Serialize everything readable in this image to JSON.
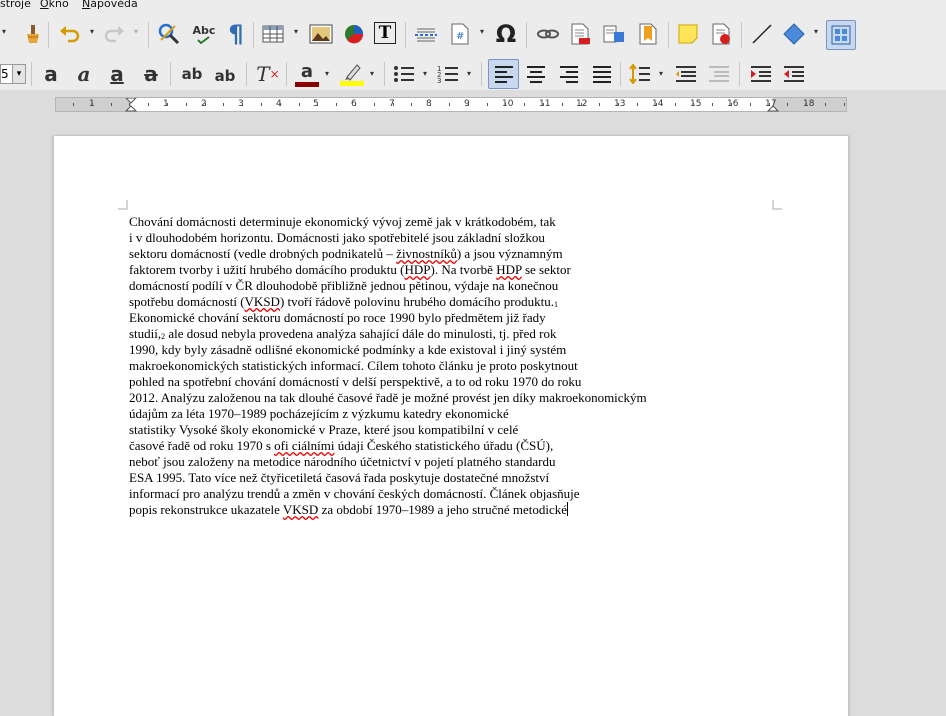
{
  "menu": {
    "items": [
      {
        "label": "stroje",
        "mnemonic": ""
      },
      {
        "label": "kno",
        "mnemonic": "O"
      },
      {
        "label": "ápověda",
        "mnemonic": "N"
      }
    ]
  },
  "toolbar": {
    "font_size_value": "5",
    "spellcheck_label": "Abc",
    "pilcrow_glyph": "¶",
    "omega_glyph": "Ω",
    "field_glyph": "#",
    "textbox_glyph": "T",
    "bold_glyph": "a",
    "italic_glyph": "a",
    "underline_glyph": "a",
    "strike_glyph": "a",
    "superscript_glyph": "ab",
    "subscript_glyph": "ab",
    "clear_glyph": "T",
    "font_color_glyph": "a",
    "font_color": "#8b0000",
    "highlight_color": "#ffff00"
  },
  "ruler": {
    "labels": [
      "1",
      "1",
      "2",
      "3",
      "4",
      "5",
      "6",
      "7",
      "8",
      "9",
      "10",
      "11",
      "12",
      "13",
      "14",
      "15",
      "16",
      "17",
      "18"
    ]
  },
  "document": {
    "lines": [
      [
        {
          "t": "Chování domácnosti determinuje ekonomický vývoj země jak v krátkodobém, tak"
        }
      ],
      [
        {
          "t": "i v dlouhodobém horizontu. Domácnosti jako spotřebitelé jsou základní složkou"
        }
      ],
      [
        {
          "t": "sektoru domácností (vedle drobných podnikatelů – "
        },
        {
          "t": "živnostníků",
          "s": 1
        },
        {
          "t": ") a jsou významným"
        }
      ],
      [
        {
          "t": "faktorem tvorby i užití hrubého domácího produktu ("
        },
        {
          "t": "HDP",
          "s": 1
        },
        {
          "t": "). Na tvorbě "
        },
        {
          "t": "HDP",
          "s": 1
        },
        {
          "t": " se sektor"
        }
      ],
      [
        {
          "t": "domácností podílí v ČR dlouhodobě přibližně jednou pětinou, výdaje na konečnou"
        }
      ],
      [
        {
          "t": "spotřebu domácností ("
        },
        {
          "t": "VKSD",
          "s": 1
        },
        {
          "t": ") tvoří řádově polovinu hrubého domácího produktu."
        },
        {
          "t": "1",
          "sup": 1
        }
      ],
      [
        {
          "t": "Ekonomické chování sektoru domácností po roce 1990 bylo předmětem již řady"
        }
      ],
      [
        {
          "t": "studií,"
        },
        {
          "t": "2",
          "sup": 1
        },
        {
          "t": " ale dosud nebyla provedena analýza sahající dále do minulosti, tj. před rok"
        }
      ],
      [
        {
          "t": "1990, kdy byly zásadně odlišné ekonomické podmínky a kde existoval i jiný systém"
        }
      ],
      [
        {
          "t": "makroekonomických statistických informací. Cílem tohoto článku je proto poskytnout"
        }
      ],
      [
        {
          "t": "pohled na spotřební chování domácností v delší perspektivě, a to od roku 1970 do roku"
        }
      ],
      [
        {
          "t": "2012. Analýzu založenou na tak dlouhé časové řadě je možné provést jen díky makroekonomickým"
        }
      ],
      [
        {
          "t": "údajům za léta 1970–1989 pocházejícím z výzkumu katedry ekonomické"
        }
      ],
      [
        {
          "t": "statistiky Vysoké školy ekonomické v Praze, které jsou kompatibilní v celé"
        }
      ],
      [
        {
          "t": "časové řadě od roku 1970 s "
        },
        {
          "t": "ofi ciálními",
          "s": 1
        },
        {
          "t": " údaji Českého statistického úřadu (ČSÚ),"
        }
      ],
      [
        {
          "t": "neboť jsou založeny na metodice národního účetnictví v pojetí platného standardu"
        }
      ],
      [
        {
          "t": "ESA 1995. Tato více než čtyřicetiletá časová řada poskytuje dostatečné množství"
        }
      ],
      [
        {
          "t": "informací pro analýzu trendů a změn v chování českých domácností. Článek objasňuje"
        }
      ],
      [
        {
          "t": "popis rekonstrukce ukazatele "
        },
        {
          "t": "VKSD",
          "s": 1
        },
        {
          "t": " za období 1970–1989 a jeho stručné metodické"
        },
        {
          "t": "",
          "caret": 1
        }
      ]
    ]
  }
}
